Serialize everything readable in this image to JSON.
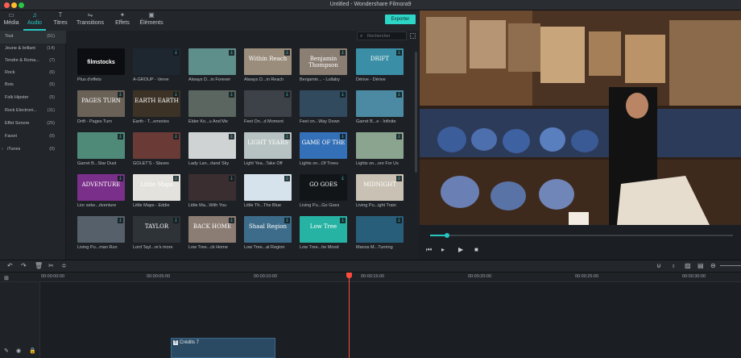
{
  "window": {
    "title": "Untitled - Wondershare Filmora9"
  },
  "tabs": [
    {
      "label": "Média",
      "icon": "folder-icon"
    },
    {
      "label": "Audio",
      "icon": "music-note-icon",
      "active": true
    },
    {
      "label": "Titres",
      "icon": "title-T-icon"
    },
    {
      "label": "Transitions",
      "icon": "transitions-icon"
    },
    {
      "label": "Effets",
      "icon": "effects-icon"
    },
    {
      "label": "Éléments",
      "icon": "elements-icon"
    }
  ],
  "export_label": "Exporter",
  "search": {
    "placeholder": "Rechercher"
  },
  "categories": [
    {
      "name": "Tout",
      "count": "(51)",
      "selected": true
    },
    {
      "name": "Jeune & brillant",
      "count": "(14)"
    },
    {
      "name": "Tendre & Roma...",
      "count": "(7)"
    },
    {
      "name": "Rock",
      "count": "(6)"
    },
    {
      "name": "Bois",
      "count": "(5)"
    },
    {
      "name": "Folk Hipster",
      "count": "(5)"
    },
    {
      "name": "Rock Electroni...",
      "count": "(11)"
    },
    {
      "name": "Effet Sonore",
      "count": "(25)"
    },
    {
      "name": "Favori",
      "count": "(0)"
    },
    {
      "name": "iTunes",
      "count": "(0)"
    }
  ],
  "tracks": [
    {
      "caption": "Plus d'effets",
      "thumb": "filmstocks",
      "bg": "#0b0d10",
      "download": false
    },
    {
      "caption": "A-GROUP - Verve",
      "thumb": "",
      "bg": "#1e2630",
      "download": true
    },
    {
      "caption": "Always D...in Forever",
      "thumb": "",
      "bg": "#5f8f8a",
      "download": true
    },
    {
      "caption": "Always D...in Reach",
      "thumb": "Within Reach",
      "bg": "#9a8d7c",
      "download": true
    },
    {
      "caption": "Benjamin... - Lullaby",
      "thumb": "Benjamin Thompson",
      "bg": "#8b7e73",
      "download": true
    },
    {
      "caption": "Dérive - Dérive",
      "thumb": "DRIFT",
      "bg": "#3a8fa6",
      "download": true
    },
    {
      "caption": "Drift - Pages Turn",
      "thumb": "PAGES TURN",
      "bg": "#6b6257",
      "download": true
    },
    {
      "caption": "Earth - T...emories",
      "thumb": "EARTH EARTH",
      "bg": "#3c3226",
      "download": true
    },
    {
      "caption": "Elder Ko...u And Me",
      "thumb": "",
      "bg": "#5a665f",
      "download": true
    },
    {
      "caption": "Feet On...d Moment",
      "thumb": "",
      "bg": "#3d4248",
      "download": true
    },
    {
      "caption": "Feet on...Way Down",
      "thumb": "",
      "bg": "#324a5e",
      "download": true
    },
    {
      "caption": "Garret B...e - Infinite",
      "thumb": "",
      "bg": "#4c8aa3",
      "download": true
    },
    {
      "caption": "Garret B...Star Dust",
      "thumb": "",
      "bg": "#4f8a78",
      "download": true
    },
    {
      "caption": "GOLET'S - Slaves",
      "thumb": "",
      "bg": "#6a3a36",
      "download": true
    },
    {
      "caption": "Lady Lan...rland Sky",
      "thumb": "",
      "bg": "#cfd3d4",
      "download": true
    },
    {
      "caption": "Light Yea...Take Off",
      "thumb": "LIGHT YEARS",
      "bg": "#b7c3c2",
      "download": true
    },
    {
      "caption": "Lights on...Of Trees",
      "thumb": "GAME OF THE",
      "bg": "#3470b8",
      "download": true
    },
    {
      "caption": "Lights on...ore For Us",
      "thumb": "",
      "bg": "#8aa48f",
      "download": true
    },
    {
      "caption": "Lior seke...dventure",
      "thumb": "ADVENTURE",
      "bg": "#7a2f8a",
      "download": true
    },
    {
      "caption": "Little Maps - Eddie",
      "thumb": "Little Maps",
      "bg": "#e4e2dc",
      "download": true
    },
    {
      "caption": "Little Ma...With You",
      "thumb": "",
      "bg": "#3a2e30",
      "download": true
    },
    {
      "caption": "Little Th...The Blue",
      "thumb": "",
      "bg": "#d6e3ec",
      "download": true
    },
    {
      "caption": "Living Pu...Go Goes",
      "thumb": "GO GOES",
      "bg": "#121518",
      "download": true
    },
    {
      "caption": "Living Pu...ight Train",
      "thumb": "MIDNIGHT",
      "bg": "#c9c1b3",
      "download": true
    },
    {
      "caption": "Living Pu...man Run",
      "thumb": "",
      "bg": "#55606a",
      "download": true
    },
    {
      "caption": "Lord Tayl...re's more",
      "thumb": "TAYLOR",
      "bg": "#2e3338",
      "download": true
    },
    {
      "caption": "Low Tree...ck Home",
      "thumb": "BACK HOME",
      "bg": "#8c7d74",
      "download": true
    },
    {
      "caption": "Low Tree...al Region",
      "thumb": "Shaal Region",
      "bg": "#3d6c8a",
      "download": true
    },
    {
      "caption": "Low Tree...he Mood",
      "thumb": "Low Tree",
      "bg": "#27b3a3",
      "download": true
    },
    {
      "caption": "Manos M...Turning",
      "thumb": "",
      "bg": "#285e7a",
      "download": true
    }
  ],
  "timeline": {
    "ruler": [
      "00:00:00:00",
      "00:00:05:00",
      "00:00:10:00",
      "00:00:15:00",
      "00:00:20:00",
      "00:00:25:00",
      "00:00:30:00"
    ],
    "clip_label": "Crédits 7"
  },
  "colors": {
    "accent": "#27c6c1",
    "playhead": "#ff4a3d",
    "export": "#2ed6c7"
  }
}
